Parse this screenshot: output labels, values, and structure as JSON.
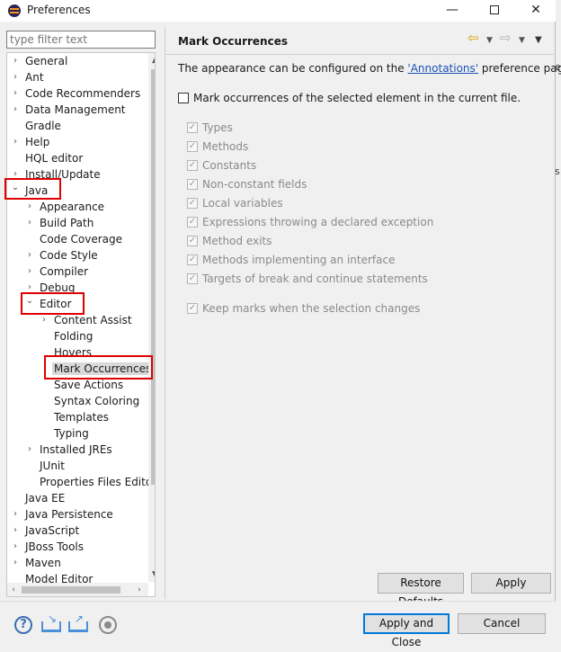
{
  "window": {
    "title": "Preferences",
    "minimize": "—",
    "close": "✕"
  },
  "filter": {
    "placeholder": "type filter text"
  },
  "tree": {
    "items": [
      {
        "label": "General",
        "arrow": "›"
      },
      {
        "label": "Ant",
        "arrow": "›"
      },
      {
        "label": "Code Recommenders",
        "arrow": "›"
      },
      {
        "label": "Data Management",
        "arrow": "›"
      },
      {
        "label": "Gradle",
        "arrow": ""
      },
      {
        "label": "Help",
        "arrow": "›"
      },
      {
        "label": "HQL editor",
        "arrow": ""
      },
      {
        "label": "Install/Update",
        "arrow": "›"
      },
      {
        "label": "Java",
        "arrow": "⌄"
      },
      {
        "label": "Appearance",
        "arrow": "›"
      },
      {
        "label": "Build Path",
        "arrow": "›"
      },
      {
        "label": "Code Coverage",
        "arrow": ""
      },
      {
        "label": "Code Style",
        "arrow": "›"
      },
      {
        "label": "Compiler",
        "arrow": "›"
      },
      {
        "label": "Debug",
        "arrow": "›"
      },
      {
        "label": "Editor",
        "arrow": "⌄"
      },
      {
        "label": "Content Assist",
        "arrow": "›"
      },
      {
        "label": "Folding",
        "arrow": ""
      },
      {
        "label": "Hovers",
        "arrow": ""
      },
      {
        "label": "Mark Occurrences",
        "arrow": ""
      },
      {
        "label": "Save Actions",
        "arrow": ""
      },
      {
        "label": "Syntax Coloring",
        "arrow": ""
      },
      {
        "label": "Templates",
        "arrow": ""
      },
      {
        "label": "Typing",
        "arrow": ""
      },
      {
        "label": "Installed JREs",
        "arrow": "›"
      },
      {
        "label": "JUnit",
        "arrow": ""
      },
      {
        "label": "Properties Files Editor",
        "arrow": ""
      },
      {
        "label": "Java EE",
        "arrow": ""
      },
      {
        "label": "Java Persistence",
        "arrow": "›"
      },
      {
        "label": "JavaScript",
        "arrow": "›"
      },
      {
        "label": "JBoss Tools",
        "arrow": "›"
      },
      {
        "label": "Maven",
        "arrow": "›"
      },
      {
        "label": "Model Editor",
        "arrow": ""
      }
    ],
    "scroll": {
      "up": "▲",
      "down": "▼",
      "left": "‹",
      "right": "›"
    }
  },
  "panel": {
    "title": "Mark Occurrences",
    "nav": {
      "back": "⇦",
      "dropdown": "▼",
      "forward": "⇨",
      "menu": "▼"
    },
    "description_before": "The appearance can be configured on the ",
    "description_link": "'Annotations'",
    "description_after": " preference page.",
    "main_checkbox": {
      "label": "Mark occurrences of the selected element in the current file.",
      "mark": ""
    },
    "options": [
      {
        "label": "Types",
        "mark": "✓"
      },
      {
        "label": "Methods",
        "mark": "✓"
      },
      {
        "label": "Constants",
        "mark": "✓"
      },
      {
        "label": "Non-constant fields",
        "mark": "✓"
      },
      {
        "label": "Local variables",
        "mark": "✓"
      },
      {
        "label": "Expressions throwing a declared exception",
        "mark": "✓"
      },
      {
        "label": "Method exits",
        "mark": "✓"
      },
      {
        "label": "Methods implementing an interface",
        "mark": "✓"
      },
      {
        "label": "Targets of break and continue statements",
        "mark": "✓"
      }
    ],
    "keep_marks": {
      "label": "Keep marks when the selection changes",
      "mark": "✓"
    },
    "restore_defaults": "Restore Defaults",
    "apply": "Apply"
  },
  "footer": {
    "help_icon": "?",
    "import_arrow": "↘",
    "export_arrow": "↗",
    "apply_close": "Apply and Close",
    "cancel": "Cancel"
  },
  "background": {
    "fragment_1": "e",
    "fragment_2": "s"
  }
}
